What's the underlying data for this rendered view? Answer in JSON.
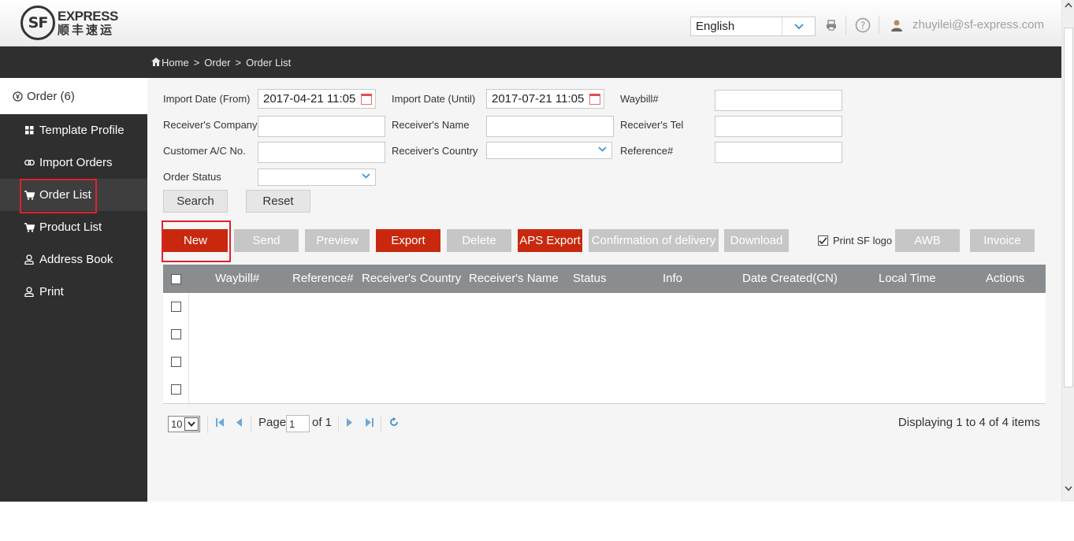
{
  "header": {
    "logo_en": "EXPRESS",
    "logo_cn": "顺丰速运",
    "logo_mark": "SF",
    "language": "English",
    "user_email": "zhuyilei@sf-express.com"
  },
  "breadcrumb": {
    "home": "Home",
    "sep": ">",
    "section": "Order",
    "page": "Order List"
  },
  "sidebar": {
    "header": "Order (6)",
    "items": [
      {
        "label": "Template Profile",
        "icon": "grid-icon"
      },
      {
        "label": "Import Orders",
        "icon": "link-icon"
      },
      {
        "label": "Order List",
        "icon": "cart-icon"
      },
      {
        "label": "Product List",
        "icon": "cart-icon"
      },
      {
        "label": "Address Book",
        "icon": "person-icon"
      },
      {
        "label": "Print",
        "icon": "person-icon"
      }
    ]
  },
  "filters": {
    "import_from_label": "Import Date (From)",
    "import_from_value": "2017-04-21 11:05",
    "import_until_label": "Import Date (Until)",
    "import_until_value": "2017-07-21 11:05",
    "waybill_label": "Waybill#",
    "receiver_company_label": "Receiver's Company",
    "receiver_name_label": "Receiver's Name",
    "receiver_tel_label": "Receiver's Tel",
    "customer_ac_label": "Customer A/C No.",
    "receiver_country_label": "Receiver's Country",
    "reference_label": "Reference#",
    "order_status_label": "Order Status",
    "search": "Search",
    "reset": "Reset"
  },
  "actions": {
    "new": "New",
    "send": "Send",
    "preview": "Preview",
    "export": "Export",
    "delete": "Delete",
    "aps_export": "APS Export",
    "confirmation": "Confirmation of delivery",
    "download": "Download",
    "print_logo": "Print SF logo",
    "awb": "AWB",
    "invoice": "Invoice"
  },
  "table": {
    "columns": [
      "Waybill#",
      "Reference#",
      "Receiver's Country",
      "Receiver's Name",
      "Status",
      "Info",
      "Date Created(CN)",
      "Local Time",
      "Actions"
    ],
    "row_count": 4
  },
  "pager": {
    "page_size": "10",
    "page_label": "Page",
    "page_value": "1",
    "of_label": "of 1",
    "summary": "Displaying 1 to 4 of 4 items"
  },
  "colors": {
    "accent_red": "#c8290e",
    "dark_bg": "#2f2f2f",
    "header_grey": "#8a8d8f"
  }
}
